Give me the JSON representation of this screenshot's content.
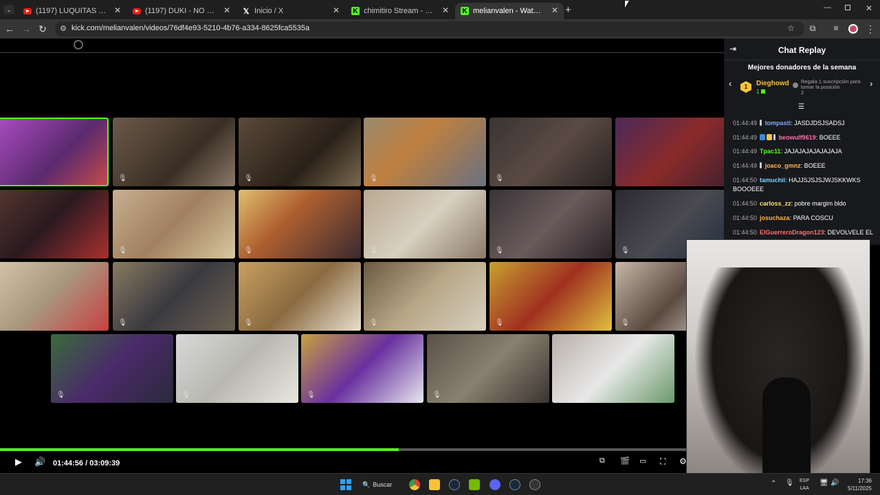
{
  "browser": {
    "tabs": [
      {
        "title": "(1197) LUQUITAS RODRÍGUEZ",
        "favicon": "youtube-icon",
        "active": false
      },
      {
        "title": "(1197) DUKI - NO ME ALCANZA",
        "favicon": "youtube-icon",
        "active": false
      },
      {
        "title": "Inicio / X",
        "favicon": "x-icon",
        "active": false
      },
      {
        "title": "chimitiro Stream - Watch Live o",
        "favicon": "kick-icon",
        "active": false
      },
      {
        "title": "melianvalen - Watch the VOD o",
        "favicon": "kick-icon",
        "active": true
      }
    ],
    "new_tab": "+",
    "url": "kick.com/melianvalen/videos/76df4e93-5210-4b76-a334-8625fca5535a"
  },
  "player": {
    "current_time": "01:44:56",
    "duration": "03:09:39",
    "progress_fraction": 0.58
  },
  "chat": {
    "title": "Chat Replay",
    "donors_title": "Mejores donadores de la semana",
    "top_donor": {
      "rank": "1",
      "name": "Dieghowd",
      "count": "1"
    },
    "gift_prompt": "Regala 1 suscripción para tomar la posición",
    "gift_position": "2",
    "messages": [
      {
        "time": "01:44:49",
        "user": "tompasti",
        "color": "#7fa7ff",
        "text": "JASDJDSJSADSJ"
      },
      {
        "time": "01:44:49",
        "user": "beowulf9619",
        "color": "#ff6fa8",
        "text": "BOEEE"
      },
      {
        "time": "01:44:49",
        "user": "Tpac11",
        "color": "#53fc18",
        "text": "JAJAJAJAJAJAJAJA"
      },
      {
        "time": "01:44:49",
        "user": "joaco_gmnz",
        "color": "#ffb347",
        "text": "BOEEE"
      },
      {
        "time": "01:44:50",
        "user": "tamuchii",
        "color": "#7fd3ff",
        "text": "HAJJSJSJSJWJSKKWKS BOOOEEE"
      },
      {
        "time": "01:44:50",
        "user": "carloss_zz",
        "color": "#ffe36b",
        "text": "pobre margim bldo"
      },
      {
        "time": "01:44:50",
        "user": "josuchaza",
        "color": "#ffb347",
        "text": "PARA COSCU"
      },
      {
        "time": "01:44:50",
        "user": "ElGuerreroDragon123",
        "color": "#ff6f6f",
        "text": "DEVOLVELE EL"
      }
    ]
  },
  "taskbar": {
    "search_label": "Buscar",
    "lang_line1": "ESP",
    "lang_line2": "LAA",
    "time": "17:36",
    "date": "5/11/2025"
  }
}
